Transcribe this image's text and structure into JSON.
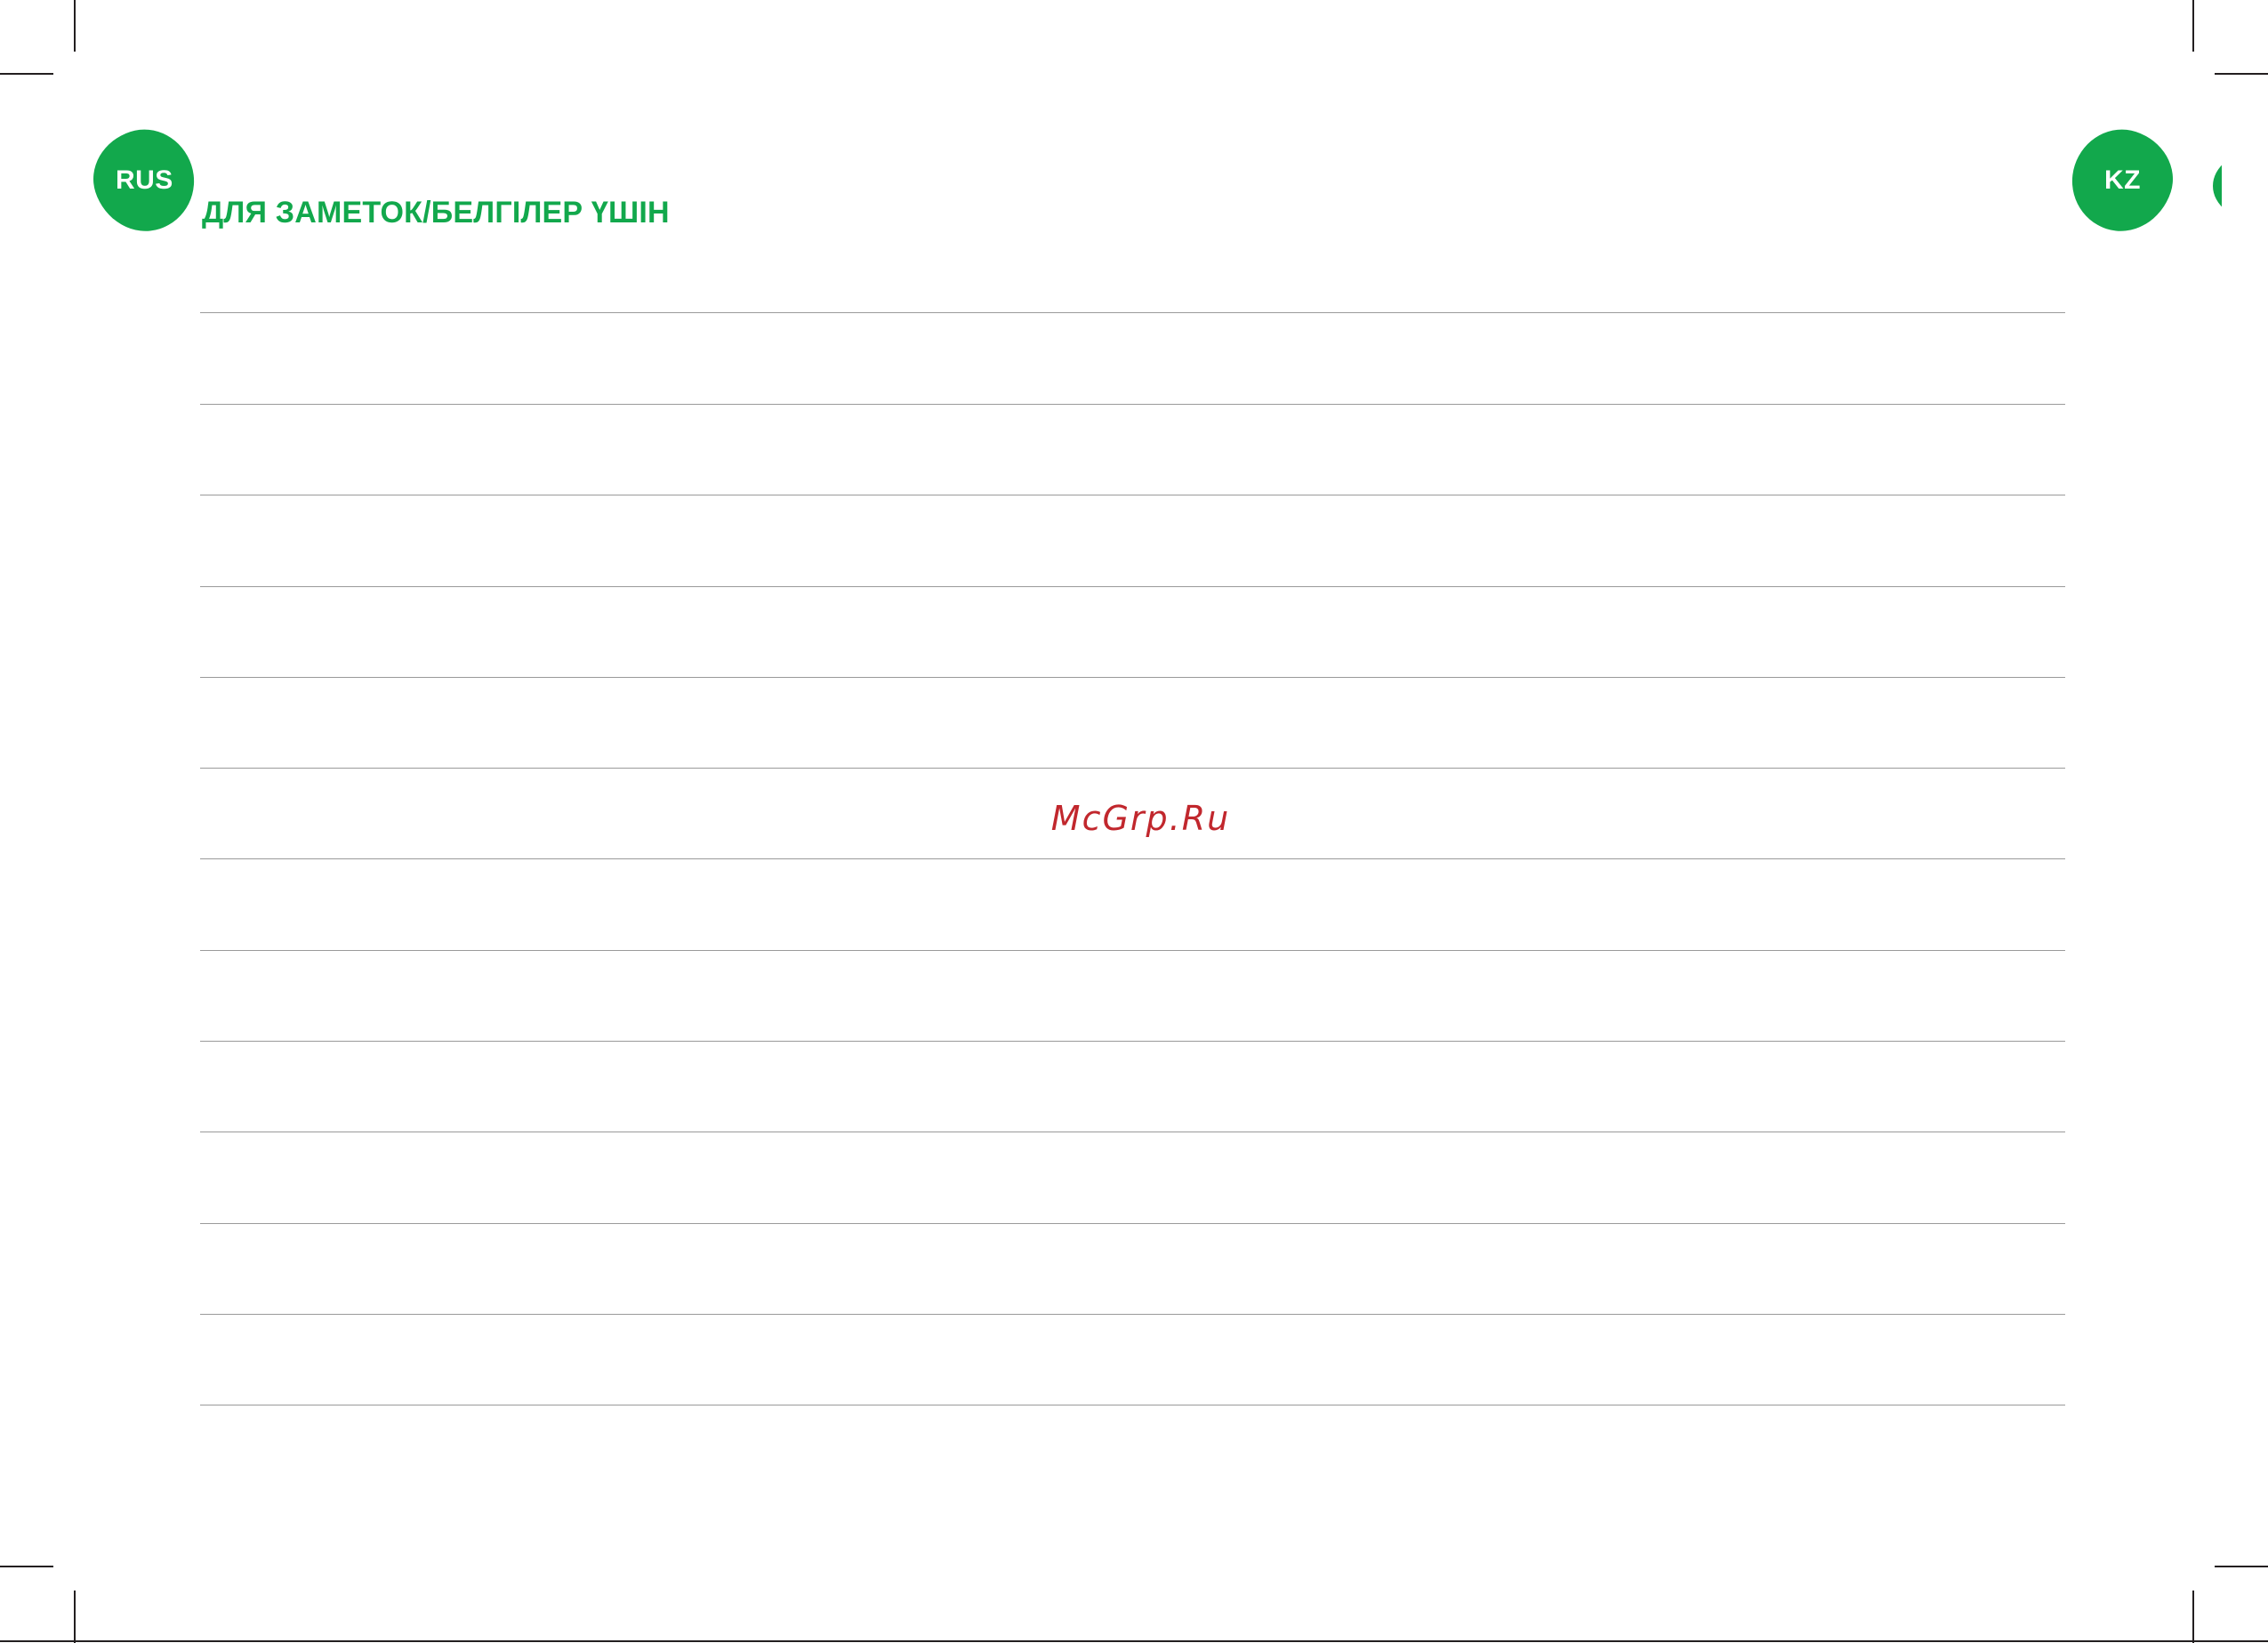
{
  "badges": {
    "left_label": "RUS",
    "right_label": "KZ",
    "color": "#12a84c"
  },
  "title": "ДЛЯ ЗАМЕТОК/БЕЛГІЛЕР ҮШІН",
  "title_color": "#12a84c",
  "ruled_line_count": 13,
  "ruled_line_color": "#9a9a9a",
  "watermark": {
    "text": "McGrp.Ru",
    "color": "#c1272d"
  }
}
